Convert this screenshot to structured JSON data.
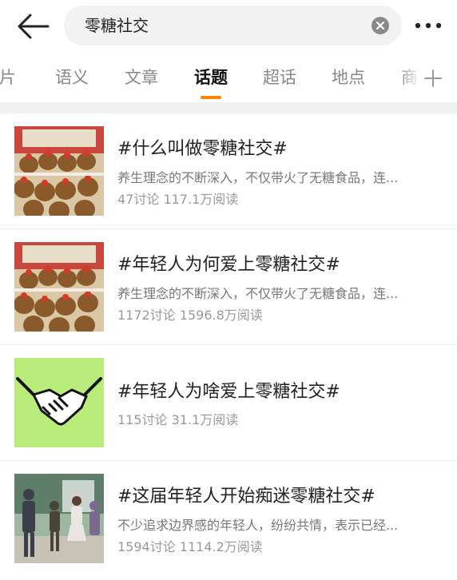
{
  "search": {
    "query": "零糖社交"
  },
  "tabs": [
    {
      "label": "图片"
    },
    {
      "label": "语义"
    },
    {
      "label": "文章"
    },
    {
      "label": "话题",
      "active": true
    },
    {
      "label": "超话"
    },
    {
      "label": "地点"
    },
    {
      "label": "商"
    }
  ],
  "colors": {
    "accent": "#ff8200",
    "thumb_green": "#b9ec7a"
  },
  "topics": [
    {
      "title": "#什么叫做零糖社交#",
      "desc": "养生理念的不断深入，不仅带火了无糖食品，连...",
      "meta": "47讨论 117.1万阅读",
      "thumb": "plush-toys"
    },
    {
      "title": "#年轻人为何爱上零糖社交#",
      "desc": "养生理念的不断深入，不仅带火了无糖食品，连...",
      "meta": "1172讨论 1596.8万阅读",
      "thumb": "plush-toys"
    },
    {
      "title": "#年轻人为啥爱上零糖社交#",
      "desc": "",
      "meta": "115讨论 31.1万阅读",
      "thumb": "handshake"
    },
    {
      "title": "#这届年轻人开始痴迷零糖社交#",
      "desc": "不少追求边界感的年轻人，纷纷共情，表示已经...",
      "meta": "1594讨论 1114.2万阅读",
      "thumb": "people-photo"
    }
  ]
}
